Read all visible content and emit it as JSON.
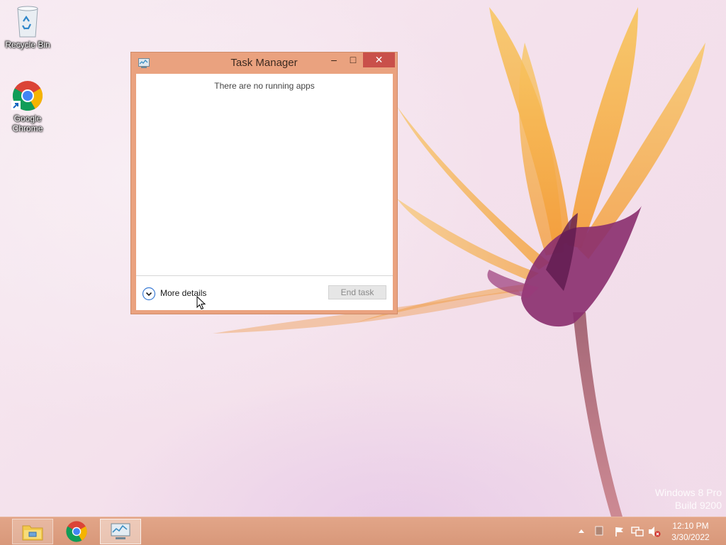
{
  "desktop": {
    "icons": [
      {
        "label": "Recycle Bin",
        "icon": "recycle-bin-icon"
      },
      {
        "label": "Google Chrome",
        "icon": "chrome-icon"
      }
    ]
  },
  "window": {
    "title": "Task Manager",
    "app_icon": "task-manager-icon",
    "minimize_glyph": "–",
    "maximize_glyph": "□",
    "close_glyph": "✕",
    "empty_message": "There are no running apps",
    "more_details_label": "More details",
    "end_task_label": "End task"
  },
  "watermark": {
    "line1": "Windows 8 Pro",
    "line2": "Build 9200"
  },
  "taskbar": {
    "pinned": [
      {
        "name": "file-explorer",
        "icon": "folder-icon"
      },
      {
        "name": "google-chrome",
        "icon": "chrome-icon"
      },
      {
        "name": "task-manager",
        "icon": "task-manager-icon",
        "active": true
      }
    ],
    "tray_icons": [
      "show-hidden-icons-arrow",
      "keyboard-icon",
      "action-center-flag-icon",
      "network-icon",
      "volume-muted-icon"
    ],
    "clock": {
      "time": "12:10 PM",
      "date": "3/30/2022"
    }
  },
  "colors": {
    "window_frame": "#eaa27f",
    "close_button": "#c9504a",
    "taskbar": "#dc9e81",
    "flower_petal": "#f6a93a",
    "flower_center": "#8a2e6e"
  }
}
